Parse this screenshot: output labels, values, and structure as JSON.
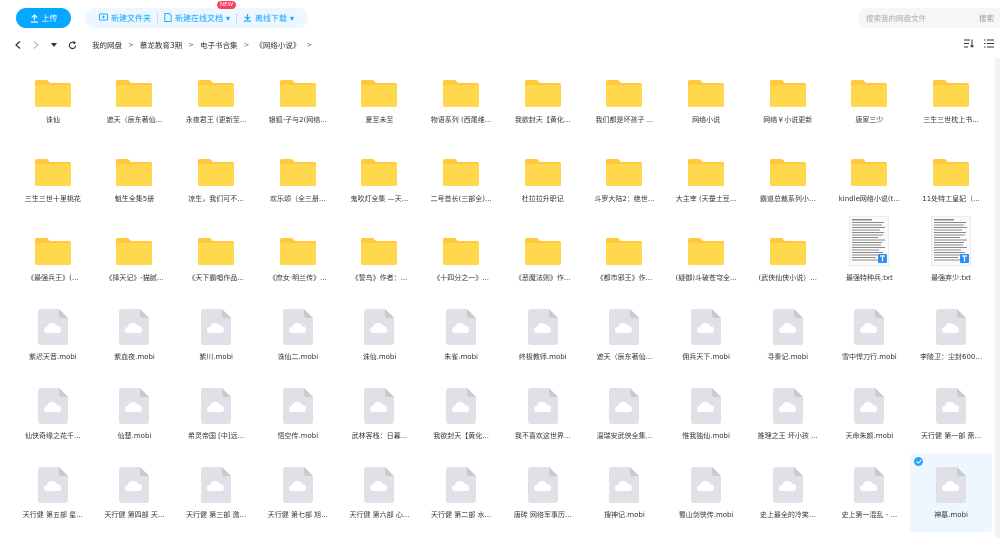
{
  "toolbar": {
    "upload_label": "上传",
    "new_folder_label": "新建文件夹",
    "new_doc_label": "新建在线文档",
    "new_badge": "NEW",
    "offline_download_label": "离线下载",
    "search_placeholder": "搜索我的网盘文件",
    "search_button": "搜索"
  },
  "breadcrumb": [
    "我的网盘",
    "慕龙教育3期",
    "电子书合集",
    "《网络小说》"
  ],
  "colors": {
    "accent": "#06a7ff",
    "folder": "#ffd24d",
    "mobi": "#dfe1e6"
  },
  "items": [
    {
      "name": "诛仙",
      "type": "folder"
    },
    {
      "name": "遮天（辰东著仙...",
      "type": "folder"
    },
    {
      "name": "永夜君王 (更新至...",
      "type": "folder"
    },
    {
      "name": "银狐-子与2(网络...",
      "type": "folder"
    },
    {
      "name": "夏至未至",
      "type": "folder"
    },
    {
      "name": "物语系列 (西尾维...",
      "type": "folder"
    },
    {
      "name": "我欲封天【黄化...",
      "type": "folder"
    },
    {
      "name": "我们都是坏孩子 ...",
      "type": "folder"
    },
    {
      "name": "网络小说",
      "type": "folder"
    },
    {
      "name": "网络￥小说更新",
      "type": "folder"
    },
    {
      "name": "唐家三少",
      "type": "folder"
    },
    {
      "name": "三生三世枕上书...",
      "type": "folder"
    },
    {
      "name": "三生三世十里桃花",
      "type": "folder"
    },
    {
      "name": "魁生全集5册",
      "type": "folder"
    },
    {
      "name": "凉生，我们可不...",
      "type": "folder"
    },
    {
      "name": "欢乐颂（全三册...",
      "type": "folder"
    },
    {
      "name": "鬼吹灯全集 —天...",
      "type": "folder"
    },
    {
      "name": "二号首长(三部全)...",
      "type": "folder"
    },
    {
      "name": "杜拉拉升职记",
      "type": "folder"
    },
    {
      "name": "斗罗大陆2：绝世...",
      "type": "folder"
    },
    {
      "name": "大主宰 (天蚕土豆...",
      "type": "folder"
    },
    {
      "name": "霸道总裁系列小...",
      "type": "folder"
    },
    {
      "name": "kindle网络小说(t...",
      "type": "folder"
    },
    {
      "name": "11处特工皇妃（...",
      "type": "folder"
    },
    {
      "name": "《最强兵王》(...",
      "type": "folder"
    },
    {
      "name": "《择天记》-猫腻...",
      "type": "folder"
    },
    {
      "name": "《天下霸唱作品...",
      "type": "folder"
    },
    {
      "name": "《庶女·明兰传》...",
      "type": "folder"
    },
    {
      "name": "《誓鸟》作者：...",
      "type": "folder"
    },
    {
      "name": "《十四分之一》...",
      "type": "folder"
    },
    {
      "name": "《恶魔法则》作...",
      "type": "folder"
    },
    {
      "name": "《都市邪王》作...",
      "type": "folder"
    },
    {
      "name": "(疑御)斗破苍穹全...",
      "type": "folder"
    },
    {
      "name": "(武侠仙侠小说）...",
      "type": "folder"
    },
    {
      "name": "最强特种兵.txt",
      "type": "txt"
    },
    {
      "name": "最强弃少.txt",
      "type": "txt"
    },
    {
      "name": "紫迟天音.mobi",
      "type": "mobi"
    },
    {
      "name": "紫血夜.mobi",
      "type": "mobi"
    },
    {
      "name": "紫川.mobi",
      "type": "mobi"
    },
    {
      "name": "诛仙二.mobi",
      "type": "mobi"
    },
    {
      "name": "诛仙.mobi",
      "type": "mobi"
    },
    {
      "name": "朱雀.mobi",
      "type": "mobi"
    },
    {
      "name": "终极教师.mobi",
      "type": "mobi"
    },
    {
      "name": "遮天（辰东著仙...",
      "type": "mobi"
    },
    {
      "name": "佣兵天下.mobi",
      "type": "mobi"
    },
    {
      "name": "寻秦记.mobi",
      "type": "mobi"
    },
    {
      "name": "雪中悍刀行.mobi",
      "type": "mobi"
    },
    {
      "name": "李陵卫：尘封600...",
      "type": "mobi"
    },
    {
      "name": "仙侠奇缘之花千...",
      "type": "mobi"
    },
    {
      "name": "仙楚.mobi",
      "type": "mobi"
    },
    {
      "name": "希灵帝国 [中]远...",
      "type": "mobi"
    },
    {
      "name": "悟空传.mobi",
      "type": "mobi"
    },
    {
      "name": "武林客栈：日暮...",
      "type": "mobi"
    },
    {
      "name": "我欲封天【黄化...",
      "type": "mobi"
    },
    {
      "name": "我不喜欢这世界...",
      "type": "mobi"
    },
    {
      "name": "温瑞安武侠全集...",
      "type": "mobi"
    },
    {
      "name": "惟我独仙.mobi",
      "type": "mobi"
    },
    {
      "name": "推理之王 坏小孩 ...",
      "type": "mobi"
    },
    {
      "name": "天命朱颜.mobi",
      "type": "mobi"
    },
    {
      "name": "天行健 第一部 斋...",
      "type": "mobi"
    },
    {
      "name": "天行健 第五部 星...",
      "type": "mobi"
    },
    {
      "name": "天行健 第四部 天...",
      "type": "mobi"
    },
    {
      "name": "天行健 第三部 激...",
      "type": "mobi"
    },
    {
      "name": "天行健 第七部 旭...",
      "type": "mobi"
    },
    {
      "name": "天行健 第六部 心...",
      "type": "mobi"
    },
    {
      "name": "天行健 第二部 水...",
      "type": "mobi"
    },
    {
      "name": "唐砖  网络军事历...",
      "type": "mobi"
    },
    {
      "name": "搜神记.mobi",
      "type": "mobi"
    },
    {
      "name": "蜀山剑侠传.mobi",
      "type": "mobi"
    },
    {
      "name": "史上最全的冷笑...",
      "type": "mobi"
    },
    {
      "name": "史上第一混乱 - ...",
      "type": "mobi"
    },
    {
      "name": "神墓.mobi",
      "type": "mobi",
      "selected": true
    }
  ]
}
